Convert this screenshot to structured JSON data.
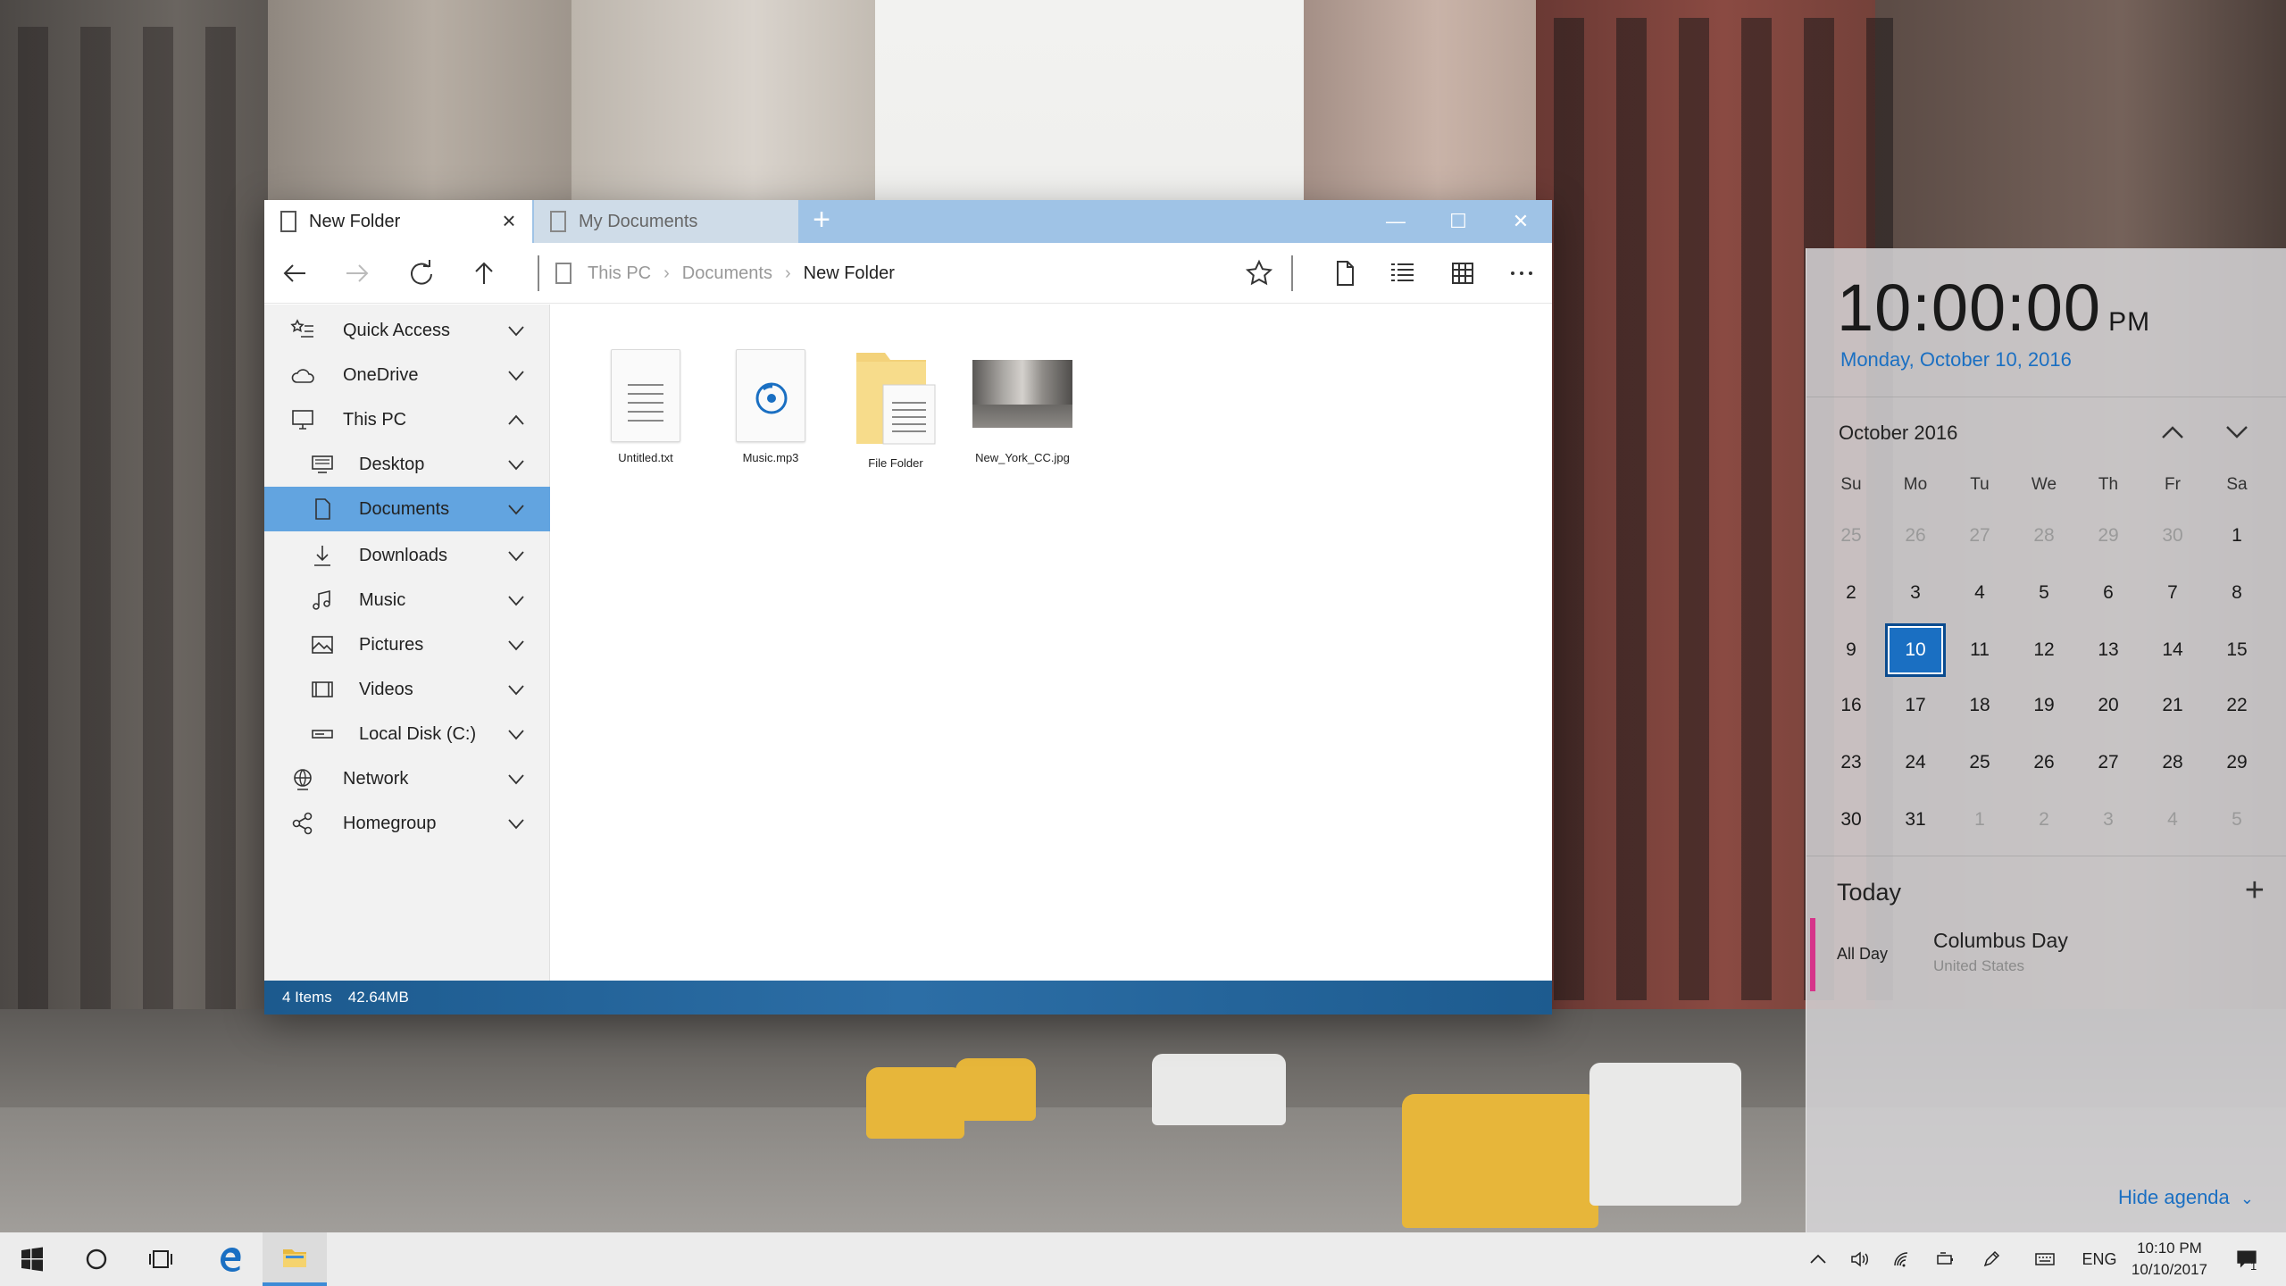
{
  "explorer": {
    "tabs": [
      {
        "label": "New Folder",
        "active": true
      },
      {
        "label": "My Documents",
        "active": false
      }
    ],
    "window_controls": {
      "minimize": "—",
      "maximize": "☐",
      "close": "✕"
    },
    "breadcrumb": [
      "This PC",
      "Documents",
      "New Folder"
    ],
    "nav": [
      {
        "label": "Quick Access",
        "icon": "star-list-icon",
        "indent": false,
        "expanded": false,
        "selected": false
      },
      {
        "label": "OneDrive",
        "icon": "cloud-icon",
        "indent": false,
        "expanded": false,
        "selected": false
      },
      {
        "label": "This PC",
        "icon": "computer-icon",
        "indent": false,
        "expanded": true,
        "selected": false
      },
      {
        "label": "Desktop",
        "icon": "desktop-icon",
        "indent": true,
        "expanded": false,
        "selected": false
      },
      {
        "label": "Documents",
        "icon": "document-icon",
        "indent": true,
        "expanded": false,
        "selected": true
      },
      {
        "label": "Downloads",
        "icon": "download-icon",
        "indent": true,
        "expanded": false,
        "selected": false
      },
      {
        "label": "Music",
        "icon": "music-icon",
        "indent": true,
        "expanded": false,
        "selected": false
      },
      {
        "label": "Pictures",
        "icon": "picture-icon",
        "indent": true,
        "expanded": false,
        "selected": false
      },
      {
        "label": "Videos",
        "icon": "video-icon",
        "indent": true,
        "expanded": false,
        "selected": false
      },
      {
        "label": "Local Disk (C:)",
        "icon": "disk-icon",
        "indent": true,
        "expanded": false,
        "selected": false
      },
      {
        "label": "Network",
        "icon": "network-icon",
        "indent": false,
        "expanded": false,
        "selected": false
      },
      {
        "label": "Homegroup",
        "icon": "homegroup-icon",
        "indent": false,
        "expanded": false,
        "selected": false
      }
    ],
    "files": [
      {
        "name": "Untitled.txt",
        "type": "text"
      },
      {
        "name": "Music.mp3",
        "type": "audio"
      },
      {
        "name": "File Folder",
        "type": "folder"
      },
      {
        "name": "New_York_CC.jpg",
        "type": "image"
      }
    ],
    "status": {
      "items": "4 Items",
      "size": "42.64MB"
    }
  },
  "calendar": {
    "time": "10:00:00",
    "ampm": "PM",
    "date_long": "Monday, October  10, 2016",
    "month_label": "October 2016",
    "weekdays": [
      "Su",
      "Mo",
      "Tu",
      "We",
      "Th",
      "Fr",
      "Sa"
    ],
    "weeks": [
      [
        [
          "25",
          1
        ],
        [
          "26",
          1
        ],
        [
          "27",
          1
        ],
        [
          "28",
          1
        ],
        [
          "29",
          1
        ],
        [
          "30",
          1
        ],
        [
          "1",
          0
        ]
      ],
      [
        [
          "2",
          0
        ],
        [
          "3",
          0
        ],
        [
          "4",
          0
        ],
        [
          "5",
          0
        ],
        [
          "6",
          0
        ],
        [
          "7",
          0
        ],
        [
          "8",
          0
        ]
      ],
      [
        [
          "9",
          0
        ],
        [
          "10",
          2
        ],
        [
          "11",
          0
        ],
        [
          "12",
          0
        ],
        [
          "13",
          0
        ],
        [
          "14",
          0
        ],
        [
          "15",
          0
        ]
      ],
      [
        [
          "16",
          0
        ],
        [
          "17",
          0
        ],
        [
          "18",
          0
        ],
        [
          "19",
          0
        ],
        [
          "20",
          0
        ],
        [
          "21",
          0
        ],
        [
          "22",
          0
        ]
      ],
      [
        [
          "23",
          0
        ],
        [
          "24",
          0
        ],
        [
          "25",
          0
        ],
        [
          "26",
          0
        ],
        [
          "27",
          0
        ],
        [
          "28",
          0
        ],
        [
          "29",
          0
        ]
      ],
      [
        [
          "30",
          0
        ],
        [
          "31",
          0
        ],
        [
          "1",
          1
        ],
        [
          "2",
          1
        ],
        [
          "3",
          1
        ],
        [
          "4",
          1
        ],
        [
          "5",
          1
        ]
      ]
    ],
    "agenda_title": "Today",
    "event": {
      "when": "All Day",
      "title": "Columbus Day",
      "subtitle": "United States",
      "color": "#d6338a"
    },
    "hide_agenda": "Hide agenda"
  },
  "taskbar": {
    "language": "ENG",
    "time": "10:10 PM",
    "date": "10/10/2017",
    "notification_count": "1"
  },
  "colors": {
    "accent": "#1a6fc2",
    "selection": "#62a4e0",
    "titlebar": "#9fc3e6",
    "statusbar": "#1c5a8e"
  }
}
